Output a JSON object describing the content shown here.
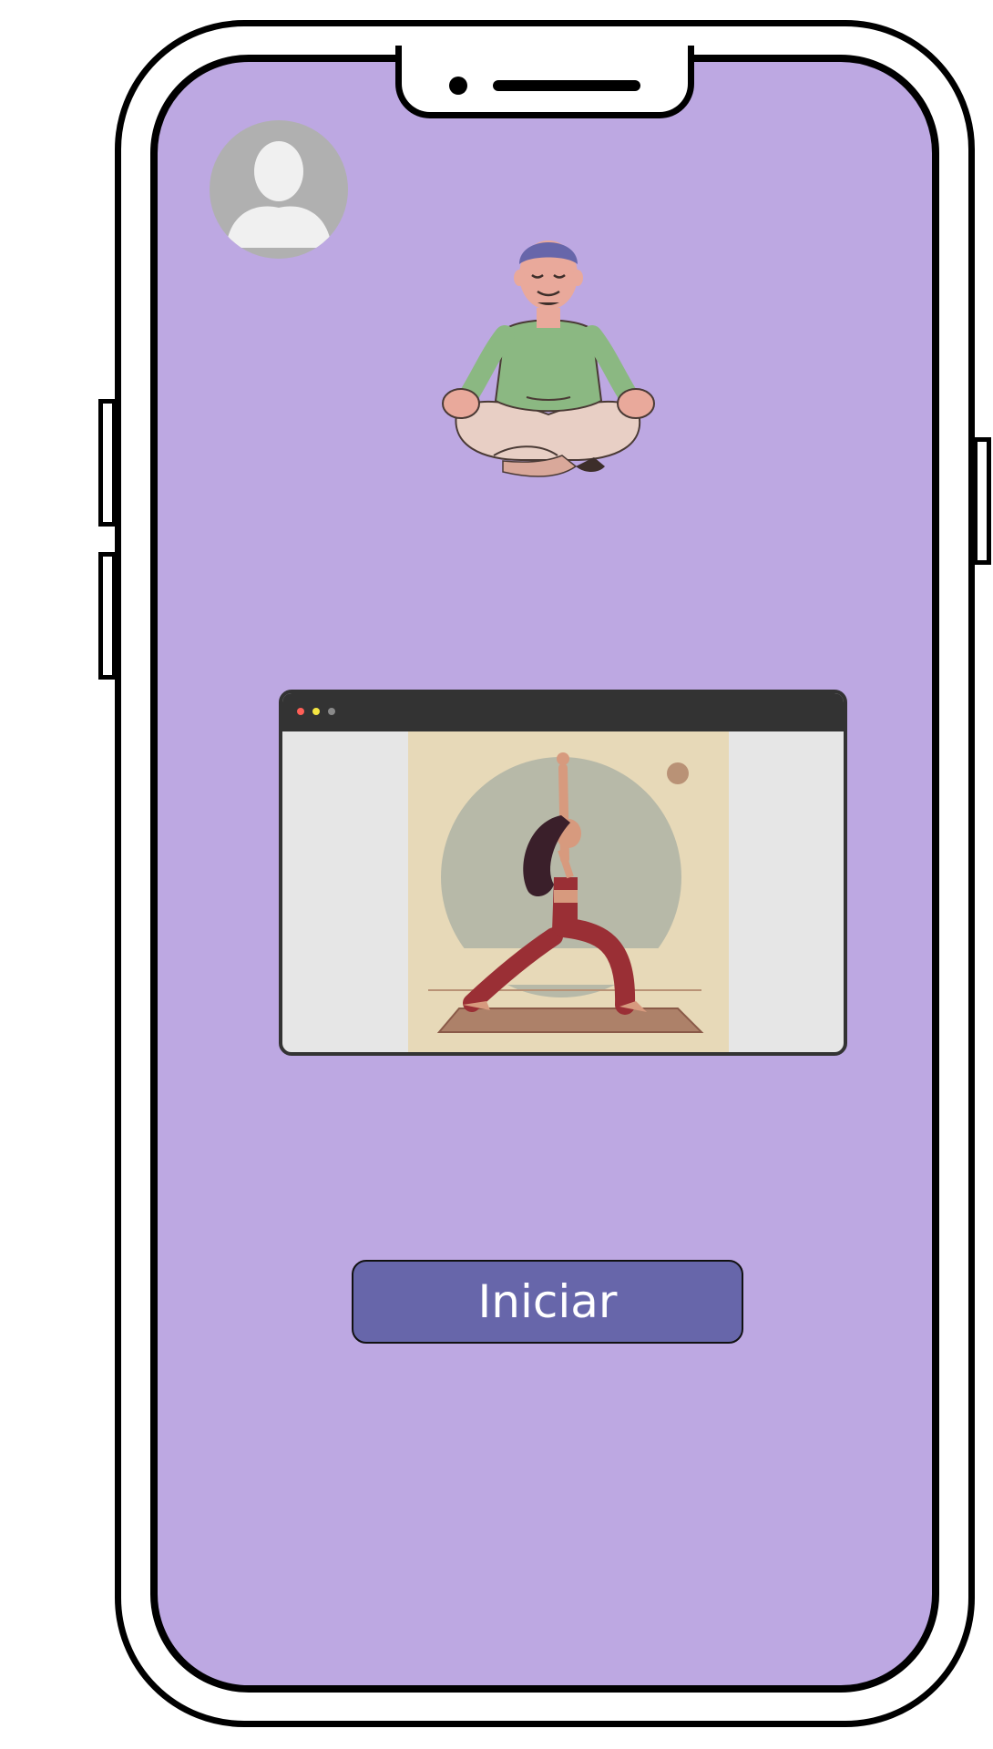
{
  "colors": {
    "screen_background": "#bda8e2",
    "button_background": "#6766aa",
    "button_text": "#ffffff",
    "frame": "#000000"
  },
  "avatar": {
    "icon": "user-avatar-icon"
  },
  "illustrations": {
    "top": "meditating-person-illustration",
    "video": "yoga-warrior-pose-illustration"
  },
  "video_window": {
    "controls": [
      "red-dot",
      "yellow-dot",
      "gray-dot"
    ]
  },
  "start_button": {
    "label": "Iniciar"
  }
}
